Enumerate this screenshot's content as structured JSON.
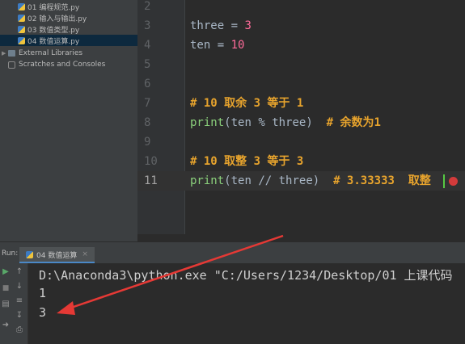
{
  "project_tree": {
    "items": [
      {
        "label": "01 编程规范.py",
        "icon": "python-file-icon"
      },
      {
        "label": "02 输入与输出.py",
        "icon": "python-file-icon"
      },
      {
        "label": "03 数值类型.py",
        "icon": "python-file-icon"
      },
      {
        "label": "04 数值运算.py",
        "icon": "python-file-icon",
        "selected": true
      },
      {
        "label": "External Libraries",
        "icon": "library-icon"
      },
      {
        "label": "Scratches and Consoles",
        "icon": "scratches-icon"
      }
    ]
  },
  "editor": {
    "current_line": 11,
    "lines": [
      {
        "num": "2",
        "code": ""
      },
      {
        "num": "3",
        "code": "three = 3"
      },
      {
        "num": "4",
        "code": "ten = 10"
      },
      {
        "num": "5",
        "code": ""
      },
      {
        "num": "6",
        "code": ""
      },
      {
        "num": "7",
        "code": "# 10 取余 3 等于 1"
      },
      {
        "num": "8",
        "code": "print(ten % three)  # 余数为1"
      },
      {
        "num": "9",
        "code": ""
      },
      {
        "num": "10",
        "code": "# 10 取整 3 等于 3"
      },
      {
        "num": "11",
        "code": "print(ten // three)  # 3.33333  取整"
      }
    ]
  },
  "run_panel": {
    "label": "Run:",
    "tab_label": "04 数值运算",
    "output": [
      "D:\\Anaconda3\\python.exe \"C:/Users/1234/Desktop/01 上课代码",
      "1",
      "3"
    ]
  },
  "colors": {
    "variable": "#a9b7c6",
    "number": "#ff6b9a",
    "comment": "#e8a42d",
    "builtin": "#8bd17c",
    "annotation_arrow": "#e53935"
  }
}
